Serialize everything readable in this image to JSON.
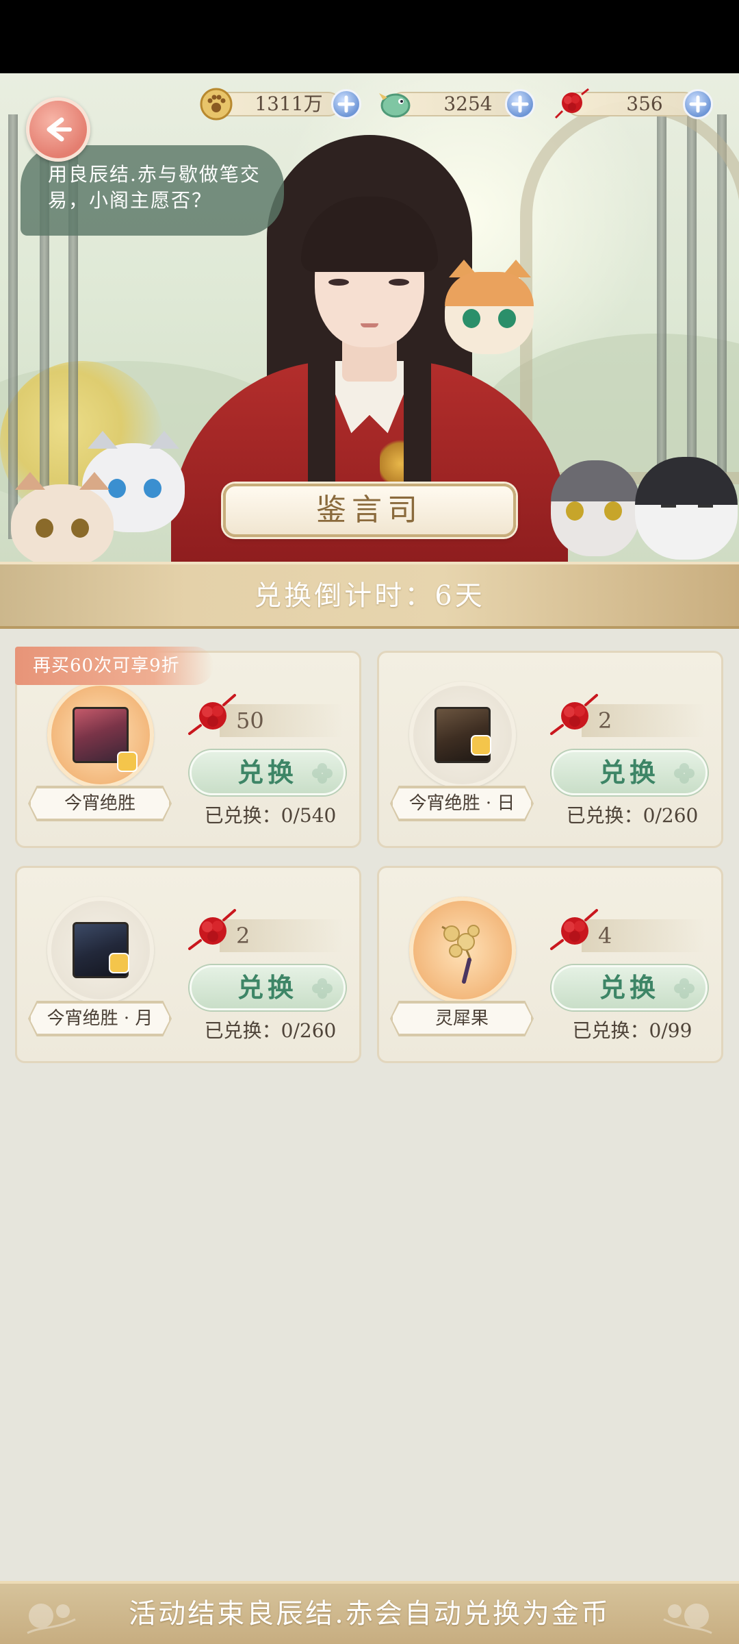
{
  "header": {
    "back_icon": "arrow-left-icon",
    "currencies": [
      {
        "icon": "paw-coin-icon",
        "value": "1311万"
      },
      {
        "icon": "jade-bird-icon",
        "value": "3254"
      },
      {
        "icon": "red-knot-icon",
        "value": "356"
      }
    ]
  },
  "hero": {
    "speech": "用良辰结.赤与歇做笔交易，小阁主愿否？",
    "plaque_title": "鉴言司"
  },
  "countdown": {
    "text": "兑换倒计时：6天"
  },
  "discount_badge": "再买60次可享9折",
  "items": [
    {
      "name": "今宵绝胜",
      "price": "50",
      "button": "兑换",
      "redeemed": "已兑换：0/540",
      "icon_bg": "gold",
      "thumb_color": "#8a4a5c"
    },
    {
      "name": "今宵绝胜 · 日",
      "price": "2",
      "button": "兑换",
      "redeemed": "已兑换：0/260",
      "icon_bg": "plain",
      "thumb_color": "#4a3a2c"
    },
    {
      "name": "今宵绝胜 · 月",
      "price": "2",
      "button": "兑换",
      "redeemed": "已兑换：0/260",
      "icon_bg": "plain",
      "thumb_color": "#2a3040"
    },
    {
      "name": "灵犀果",
      "price": "4",
      "button": "兑换",
      "redeemed": "已兑换：0/99",
      "icon_bg": "gold",
      "thumb_color": "#c9a25a"
    }
  ],
  "footer": {
    "text": "活动结束良辰结.赤会自动兑换为金币"
  },
  "colors": {
    "accent_green": "#3d8566",
    "gold": "#c7ad7b",
    "red_knot": "#c9171e"
  }
}
